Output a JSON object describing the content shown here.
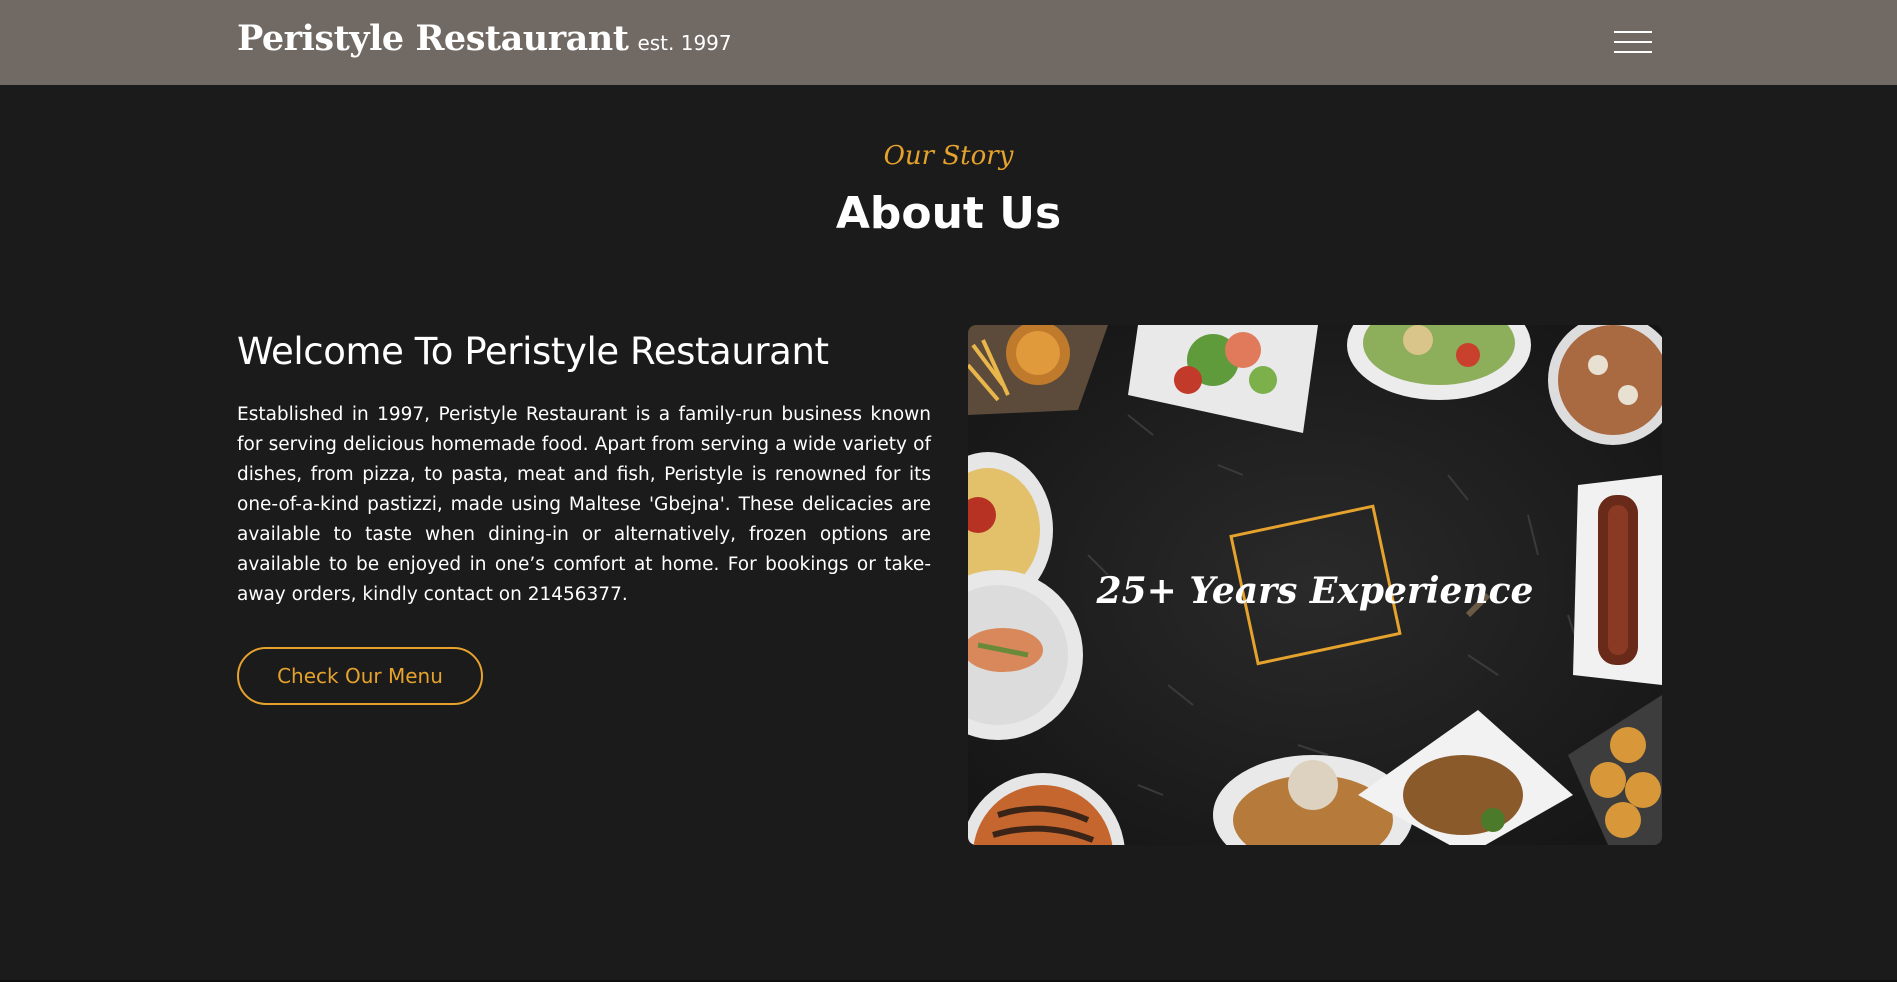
{
  "header": {
    "brand_name": "Peristyle Restaurant",
    "brand_est": "est. 1997",
    "menu_icon": "hamburger-menu-icon",
    "background_color": "#716964"
  },
  "about": {
    "eyebrow": "Our Story",
    "title": "About Us",
    "welcome_heading": "Welcome To Peristyle Restaurant",
    "body": "Established in 1997, Peristyle Restaurant is a family-run business known for serving delicious homemade food. Apart from serving a wide variety of dishes, from pizza, to pasta, meat and fish, Peristyle is renowned for its one-of-a-kind pastizzi, made using Maltese 'Gbejna'. These delicacies are available to taste when dining-in or alternatively, frozen options are available to be enjoyed in one’s comfort at home. For bookings or take-away orders, kindly contact on 21456377.",
    "button_label": "Check Our Menu"
  },
  "image": {
    "overlay_text": "25+ Years Experience"
  },
  "colors": {
    "accent": "#e5a22c",
    "page_background": "#1b1b1b",
    "text": "#ffffff"
  }
}
